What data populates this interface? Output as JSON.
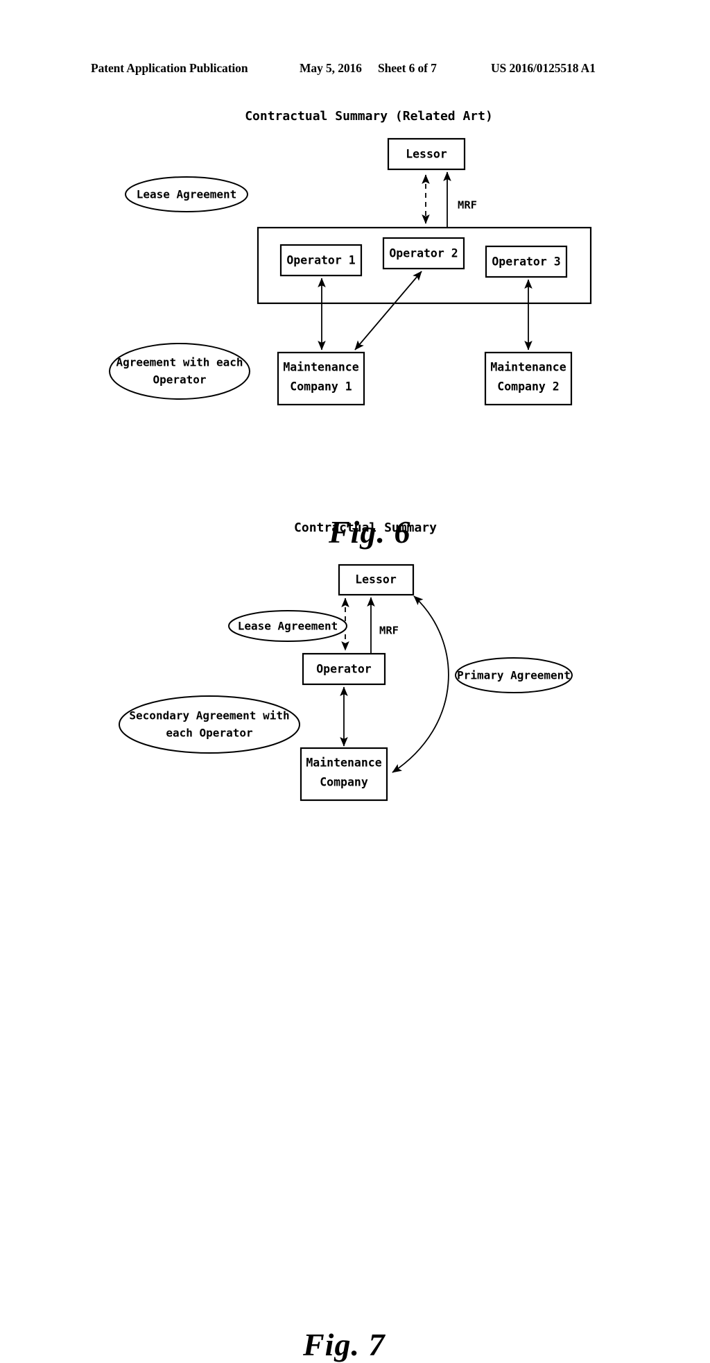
{
  "page": {
    "header": {
      "publication": "Patent Application Publication",
      "date": "May 5, 2016",
      "sheet": "Sheet 6 of 7",
      "doc_number": "US 2016/0125518 A1"
    },
    "ink_color": "#000000",
    "background_color": "#ffffff"
  },
  "figures": [
    {
      "id": "fig6",
      "caption": "Fig. 6",
      "title": "Contractual Summary (Related Art)",
      "nodes": {
        "lessor": "Lessor",
        "operator1": "Operator 1",
        "operator2": "Operator 2",
        "operator3": "Operator 3",
        "maintenance1": "Maintenance Company 1",
        "maintenance1_line1": "Maintenance",
        "maintenance1_line2": "Company 1",
        "maintenance2": "Maintenance Company 2",
        "maintenance2_line1": "Maintenance",
        "maintenance2_line2": "Company 2"
      },
      "annotations": {
        "lease_agreement": "Lease Agreement",
        "agreement_each_operator_line1": "Agreement with each",
        "agreement_each_operator_line2": "Operator",
        "mrf": "MRF"
      },
      "edges": [
        {
          "from": "operator-group",
          "to": "lessor",
          "style": "dashed",
          "arrowheads": "both",
          "label": ""
        },
        {
          "from": "operator-group",
          "to": "lessor",
          "style": "solid",
          "arrowheads": "end",
          "label": "MRF"
        },
        {
          "from": "maintenance1",
          "to": "operator1",
          "style": "solid",
          "arrowheads": "both",
          "label": ""
        },
        {
          "from": "operator2",
          "to": "maintenance1",
          "style": "solid",
          "arrowheads": "both",
          "label": ""
        },
        {
          "from": "maintenance2",
          "to": "operator3",
          "style": "solid",
          "arrowheads": "both",
          "label": ""
        }
      ]
    },
    {
      "id": "fig7",
      "caption": "Fig. 7",
      "title": "Contractual Summary",
      "nodes": {
        "lessor": "Lessor",
        "operator": "Operator",
        "maintenance": "Maintenance Company",
        "maintenance_line1": "Maintenance",
        "maintenance_line2": "Company"
      },
      "annotations": {
        "lease_agreement": "Lease Agreement",
        "primary_agreement": "Primary Agreement",
        "secondary_agreement_line1": "Secondary Agreement with",
        "secondary_agreement_line2": "each Operator",
        "mrf": "MRF"
      },
      "edges": [
        {
          "from": "operator",
          "to": "lessor",
          "style": "dashed",
          "arrowheads": "both",
          "label": ""
        },
        {
          "from": "operator",
          "to": "lessor",
          "style": "solid",
          "arrowheads": "end",
          "label": "MRF"
        },
        {
          "from": "operator",
          "to": "maintenance",
          "style": "solid",
          "arrowheads": "both",
          "label": ""
        },
        {
          "from": "maintenance",
          "to": "lessor",
          "style": "curved",
          "arrowheads": "both",
          "label": "Primary Agreement"
        }
      ]
    }
  ]
}
